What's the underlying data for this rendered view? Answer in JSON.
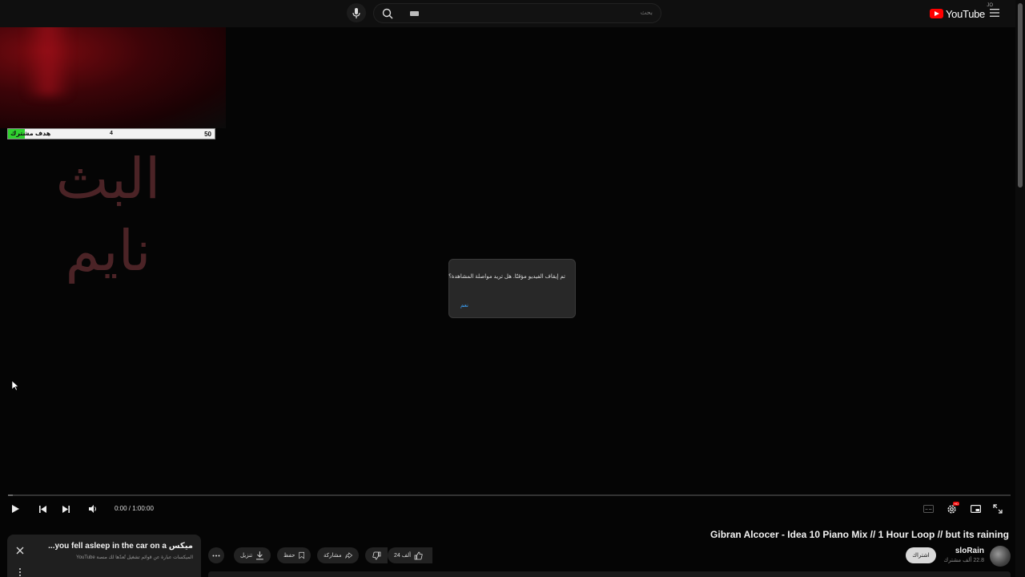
{
  "header": {
    "logo_text": "YouTube",
    "country_code": "JO",
    "search_placeholder": "بحث",
    "brand_color": "#ff0000"
  },
  "overlay": {
    "goal_label": "هدف مشترك",
    "goal_current": "4",
    "goal_target": "50",
    "goal_progress_fraction": 0.08,
    "sleeping_text": "البث نايم"
  },
  "dialog": {
    "message": "تم إيقاف الفيديو مؤقتًا. هل تريد مواصلة المشاهدة؟",
    "confirm_label": "نعم"
  },
  "player": {
    "time": "0:00 / 1:00:00",
    "progress_fraction": 0.0
  },
  "video": {
    "title": "Gibran Alcocer - Idea 10 Piano Mix // 1 Hour Loop // but its raining",
    "channel_name": "sloRain",
    "subscribers": "22.8 ألف مشترك",
    "subscribe_label": "اشتراك",
    "like_count": "24 ألف",
    "share_label": "مشاركة",
    "save_label": "حفظ",
    "download_label": "تنزيل"
  },
  "mix_card": {
    "title": "ميكس you fell asleep in the car on a...",
    "subtitle": "الميكسات عبارة عن قوائم تشغيل تُعدّها لك منصة YouTube"
  },
  "icons": [
    "menu-icon",
    "youtube-logo-icon",
    "search-icon",
    "keyboard-icon",
    "mic-icon",
    "play-icon",
    "previous-icon",
    "next-icon",
    "volume-icon",
    "subtitles-icon",
    "settings-icon",
    "miniplayer-icon",
    "fullscreen-icon",
    "like-icon",
    "dislike-icon",
    "share-icon",
    "save-icon",
    "download-icon",
    "more-icon",
    "close-icon",
    "kebab-icon"
  ]
}
